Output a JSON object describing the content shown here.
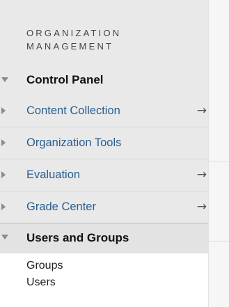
{
  "sidebar": {
    "section_title": "ORGANIZATION MANAGEMENT",
    "control_panel": "Control Panel",
    "items": [
      {
        "label": "Content Collection",
        "arrow": "→"
      },
      {
        "label": "Organization Tools",
        "arrow": ""
      },
      {
        "label": "Evaluation",
        "arrow": "→"
      },
      {
        "label": "Grade Center",
        "arrow": "→"
      }
    ],
    "users_and_groups": {
      "label": "Users and Groups",
      "children": [
        "Groups",
        "Users"
      ]
    }
  },
  "colors": {
    "panel_background": "#e9e9e9",
    "link_text": "#2a5d8f",
    "header_text": "#111111"
  },
  "icons": {
    "expanded": "caret-down-icon",
    "collapsed": "caret-right-icon",
    "arrow": "right-arrow-icon"
  }
}
